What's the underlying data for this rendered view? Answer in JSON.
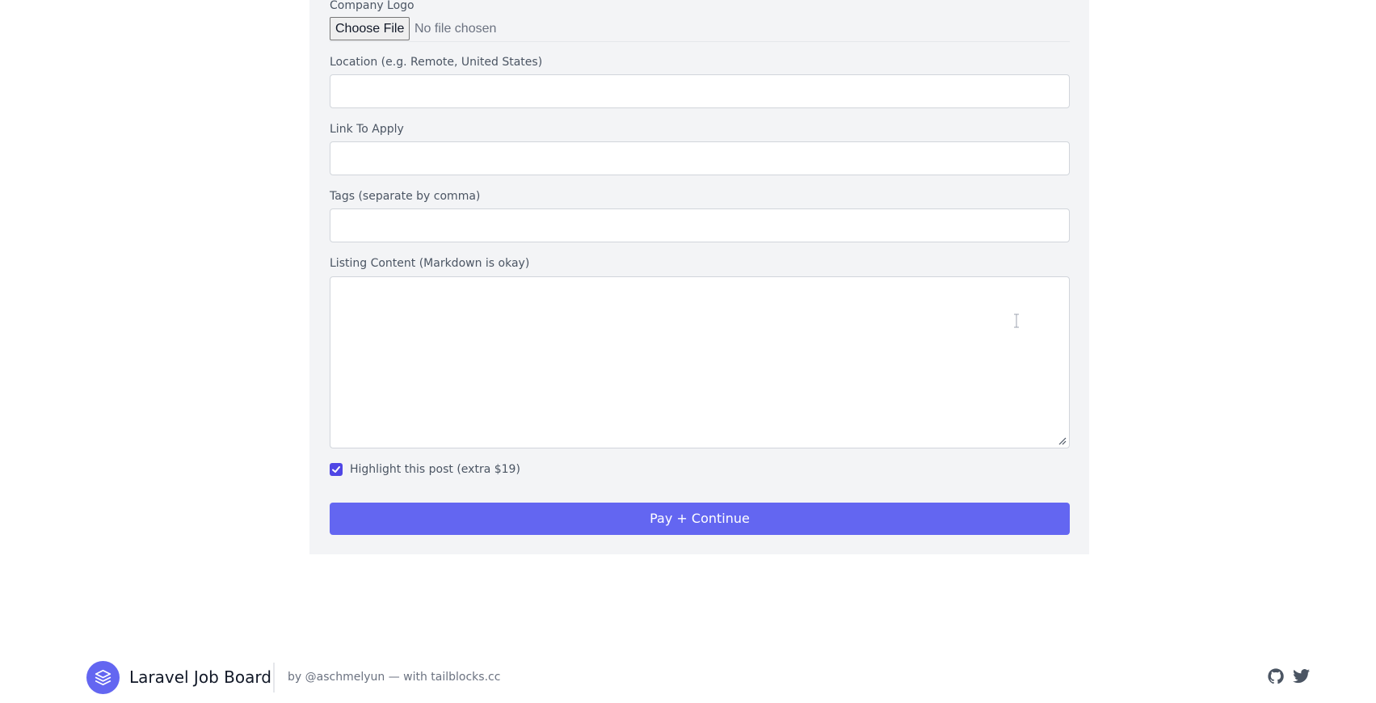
{
  "form": {
    "company_logo_label": "Company Logo",
    "file_button_label": "Choose File",
    "file_status": "No file chosen",
    "location_label": "Location (e.g. Remote, United States)",
    "location_value": "",
    "apply_link_label": "Link To Apply",
    "apply_link_value": "",
    "tags_label": "Tags (separate by comma)",
    "tags_value": "",
    "content_label": "Listing Content (Markdown is okay)",
    "content_value": "",
    "highlight_label": "Highlight this post (extra $19)",
    "highlight_checked": true,
    "submit_label": "Pay + Continue"
  },
  "footer": {
    "brand": "Laravel Job Board",
    "credit": "by @aschmelyun — with tailblocks.cc",
    "icons": [
      "github-icon",
      "twitter-icon"
    ]
  },
  "colors": {
    "accent": "#6366f1",
    "checkbox": "#4f46e5",
    "panel_bg": "#f3f4f6",
    "input_border": "#d1d5db"
  }
}
